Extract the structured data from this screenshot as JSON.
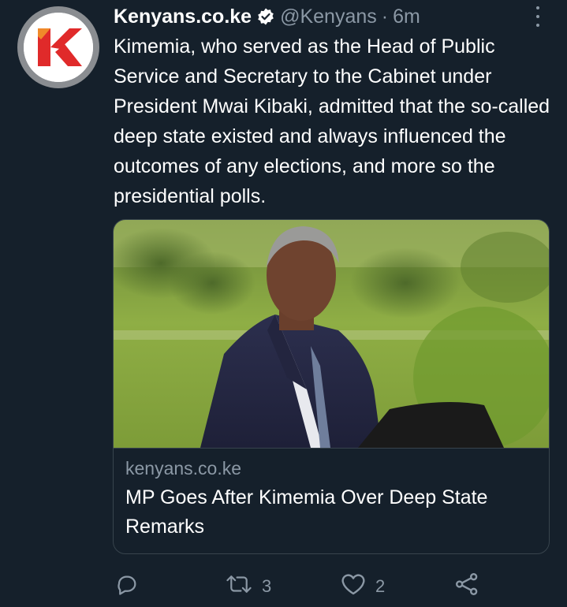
{
  "tweet": {
    "display_name": "Kenyans.co.ke",
    "handle": "@Kenyans",
    "separator": "·",
    "time": "6m",
    "text": "Kimemia, who served as the Head of Public Service and Secretary to the Cabinet under President Mwai Kibaki, admitted that the so-called deep state existed and always influenced the outcomes of any elections, and more so the presidential polls.",
    "avatar_icon": "kenyans-logo-icon",
    "verified_icon": "verified-badge-icon",
    "more_icon": "more-options-icon"
  },
  "card": {
    "domain": "kenyans.co.ke",
    "title": "MP Goes After Kimemia Over Deep State Remarks",
    "image_description_icon": "article-photo"
  },
  "actions": {
    "reply": {
      "icon": "reply-icon",
      "count": ""
    },
    "retweet": {
      "icon": "retweet-icon",
      "count": "3"
    },
    "like": {
      "icon": "like-icon",
      "count": "2"
    },
    "share": {
      "icon": "share-icon",
      "count": ""
    }
  },
  "colors": {
    "background": "#15202b",
    "secondary_text": "#8b98a5",
    "border": "#38444d",
    "logo_red": "#e02a2a"
  }
}
